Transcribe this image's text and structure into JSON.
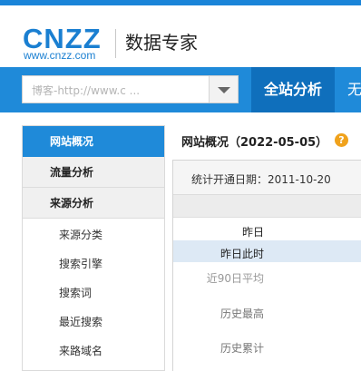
{
  "header": {
    "logo_text": "CNZZ",
    "logo_url": "www.cnzz.com",
    "brand_title": "数据专家"
  },
  "nav": {
    "site_select_value": "博客-http://www.c ...",
    "active_tab": "全站分析",
    "next_tab_partial": "无"
  },
  "sidebar": {
    "items": [
      {
        "label": "网站概况",
        "type": "active"
      },
      {
        "label": "流量分析",
        "type": "group"
      },
      {
        "label": "来源分析",
        "type": "group"
      },
      {
        "label": "来源分类",
        "type": "sub"
      },
      {
        "label": "搜索引擎",
        "type": "sub"
      },
      {
        "label": "搜索词",
        "type": "sub"
      },
      {
        "label": "最近搜索",
        "type": "sub"
      },
      {
        "label": "来路域名",
        "type": "sub"
      }
    ]
  },
  "content": {
    "title": "网站概况（2022-05-05）",
    "help_icon": "?",
    "start_date_text": "统计开通日期：2011-10-20",
    "rows": [
      "昨日",
      "昨日此时",
      "近90日平均",
      "历史最高",
      "历史累计"
    ]
  },
  "colors": {
    "brand_blue": "#1a7fd1",
    "nav_blue": "#1f8ad9",
    "active_tab_blue": "#0f6fbc",
    "help_orange": "#f0a21c"
  }
}
